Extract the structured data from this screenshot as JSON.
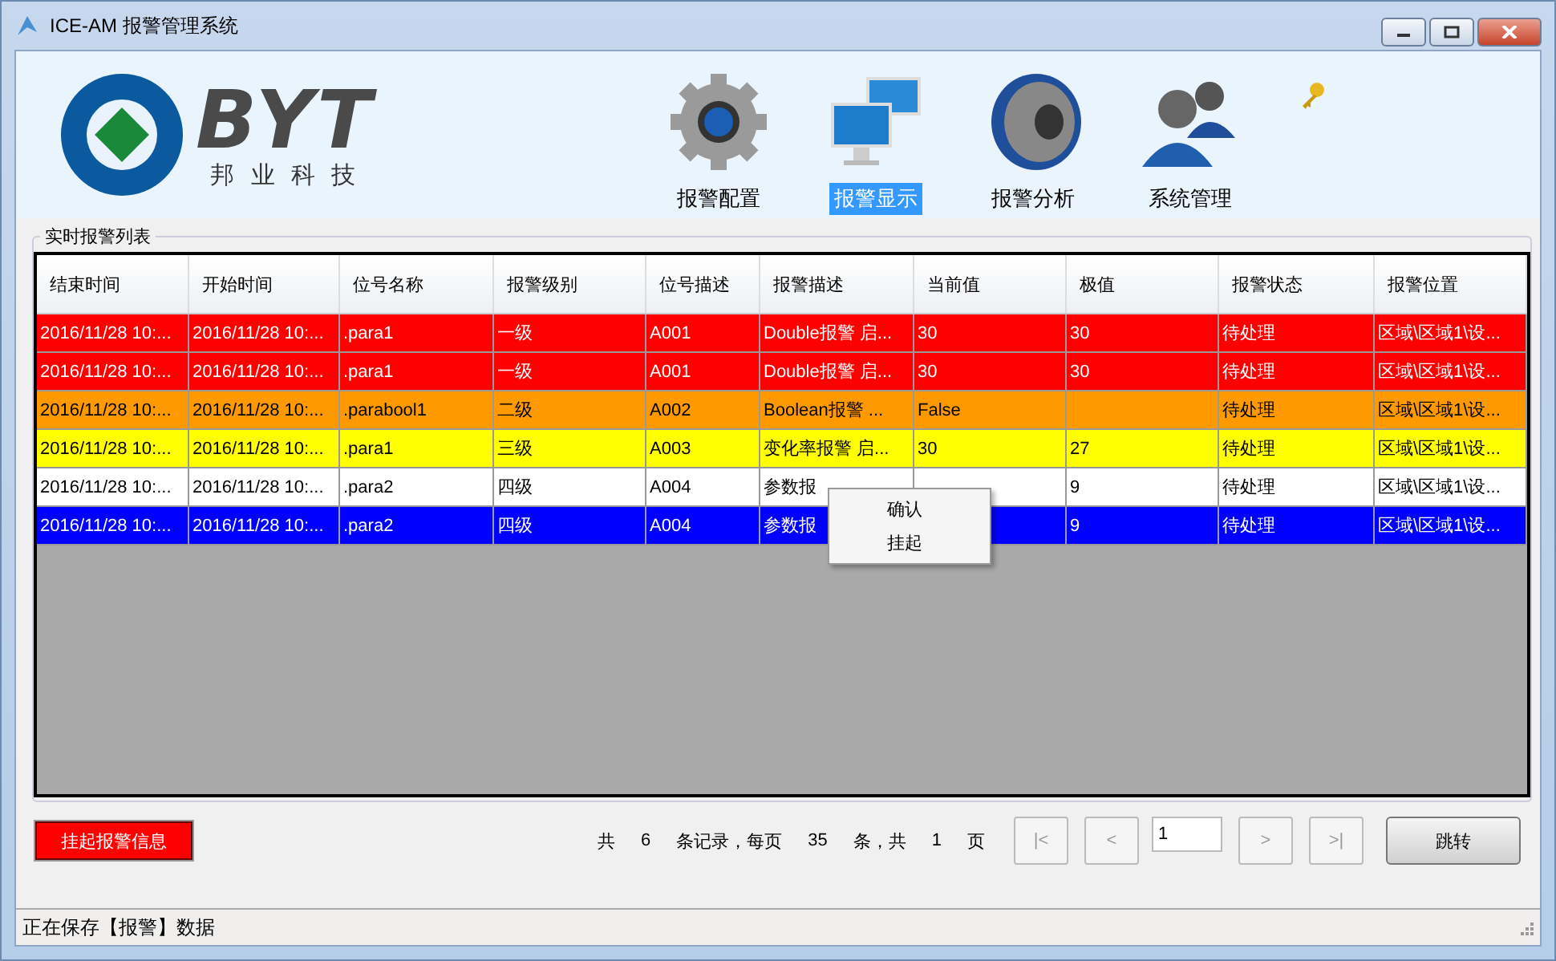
{
  "window": {
    "title": "ICE-AM 报警管理系统"
  },
  "logo": {
    "name": "BYT",
    "subtitle": "邦 业 科 技"
  },
  "nav": [
    {
      "label": "报警配置",
      "kind": "gear",
      "selected": false
    },
    {
      "label": "报警显示",
      "kind": "monitors",
      "selected": true
    },
    {
      "label": "报警分析",
      "kind": "speaker",
      "selected": false
    },
    {
      "label": "系统管理",
      "kind": "users",
      "selected": false
    }
  ],
  "group": {
    "title": "实时报警列表"
  },
  "table": {
    "columns": [
      "结束时间",
      "开始时间",
      "位号名称",
      "报警级别",
      "位号描述",
      "报警描述",
      "当前值",
      "极值",
      "报警状态",
      "报警位置"
    ],
    "rows": [
      {
        "color": "#ff0000",
        "cells": [
          "2016/11/28 10:...",
          "2016/11/28 10:...",
          ".para1",
          "一级",
          "A001",
          "Double报警 启...",
          "30",
          "30",
          "待处理",
          "区域\\区域1\\设..."
        ]
      },
      {
        "color": "#ff0000",
        "cells": [
          "2016/11/28 10:...",
          "2016/11/28 10:...",
          ".para1",
          "一级",
          "A001",
          "Double报警 启...",
          "30",
          "30",
          "待处理",
          "区域\\区域1\\设..."
        ]
      },
      {
        "color": "#ff9900",
        "cells": [
          "2016/11/28 10:...",
          "2016/11/28 10:...",
          ".parabool1",
          "二级",
          "A002",
          "Boolean报警 ...",
          "False",
          null,
          "待处理",
          "区域\\区域1\\设..."
        ]
      },
      {
        "color": "#ffff00",
        "cells": [
          "2016/11/28 10:...",
          "2016/11/28 10:...",
          ".para1",
          "三级",
          "A003",
          "变化率报警 启...",
          "30",
          "27",
          "待处理",
          "区域\\区域1\\设..."
        ]
      },
      {
        "color": "#ffffff",
        "cells": [
          "2016/11/28 10:...",
          "2016/11/28 10:...",
          ".para2",
          "四级",
          "A004",
          "参数报",
          null,
          "9",
          "待处理",
          "区域\\区域1\\设..."
        ]
      },
      {
        "color": "#0000ff",
        "cells": [
          "2016/11/28 10:...",
          "2016/11/28 10:...",
          ".para2",
          "四级",
          "A004",
          "参数报",
          null,
          "9",
          "待处理",
          "区域\\区域1\\设..."
        ]
      }
    ]
  },
  "context_menu": [
    "确认",
    "挂起"
  ],
  "suspend_button": "挂起报警信息",
  "pager": {
    "texts": [
      "共",
      "6",
      "条记录，每页",
      "35",
      "条，共",
      "1",
      "页"
    ],
    "first": "|<",
    "prev": "<",
    "page": "1",
    "next": ">",
    "last": ">|",
    "jump": "跳转"
  },
  "status_bar": "正在保存【报警】数据"
}
